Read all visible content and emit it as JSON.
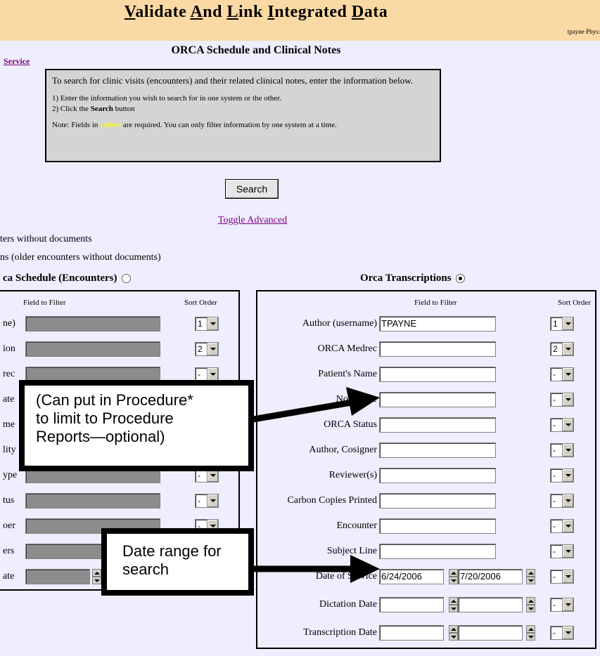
{
  "header": {
    "app_title_parts": [
      {
        "first": "V",
        "rest": "alidate "
      },
      {
        "first": "A",
        "rest": "nd "
      },
      {
        "first": "L",
        "rest": "ink "
      },
      {
        "first": "I",
        "rest": "ntegrated "
      },
      {
        "first": "D",
        "rest": "ata"
      }
    ],
    "user": "tpayne Phys:",
    "page_title": "ORCA Schedule and Clinical Notes",
    "service_link": "Service"
  },
  "instructions": {
    "intro": "To search for clinic visits (encounters) and their related clinical notes, enter the information below.",
    "step1": "1) Enter the information you wish to search for in one system or the other.",
    "step2_pre": "2) Click the ",
    "step2_bold": "Search",
    "step2_post": " button",
    "note_pre": "Note: Fields in ",
    "note_colored": "yellow",
    "note_post": " are required. You can only filter information by one system at a time."
  },
  "search_button": "Search",
  "toggle_advanced": "Toggle Advanced",
  "option_lines": [
    "ters without documents",
    "ns (older encounters without documents)"
  ],
  "left_section": {
    "title": "ca Schedule (Encounters)",
    "selected": false,
    "field_header": "Field to Filter",
    "sort_header": "Sort Order",
    "rows": [
      {
        "label": "ne)",
        "sort": "1"
      },
      {
        "label": "ion",
        "sort": "2"
      },
      {
        "label": "rec",
        "sort": "-"
      },
      {
        "label": "ate",
        "sort": "-"
      },
      {
        "label": "me",
        "sort": "-"
      },
      {
        "label": "lity",
        "sort": "-"
      },
      {
        "label": "ype",
        "sort": "-"
      },
      {
        "label": "tus",
        "sort": "-"
      },
      {
        "label": "oer",
        "sort": "-"
      },
      {
        "label": "ers",
        "sort": "-"
      },
      {
        "label": "ate",
        "sort": "-"
      }
    ]
  },
  "right_section": {
    "title": "Orca Transcriptions",
    "selected": true,
    "field_header": "Field to Filter",
    "sort_header": "Sort Order",
    "rows": [
      {
        "label": "Author (username)",
        "value": "TPAYNE",
        "sort": "1"
      },
      {
        "label": "ORCA Medrec",
        "value": "",
        "sort": "2"
      },
      {
        "label": "Patient's Name",
        "value": "",
        "sort": "-"
      },
      {
        "label": "Note Type",
        "value": "",
        "sort": "-"
      },
      {
        "label": "ORCA Status",
        "value": "",
        "sort": "-"
      },
      {
        "label": "Author, Cosigner",
        "value": "",
        "sort": "-"
      },
      {
        "label": "Reviewer(s)",
        "value": "",
        "sort": "-"
      },
      {
        "label": "Carbon Copies Printed",
        "value": "",
        "sort": "-"
      },
      {
        "label": "Encounter",
        "value": "",
        "sort": "-"
      },
      {
        "label": "Subject Line",
        "value": "",
        "sort": "-"
      },
      {
        "label": "Date of Service",
        "from": "6/24/2006",
        "to": "7/20/2006",
        "sort": "-"
      },
      {
        "label": "Dictation Date",
        "from": "",
        "to": "",
        "sort": "-"
      },
      {
        "label": "Transcription Date",
        "from": "",
        "to": "",
        "sort": "-"
      }
    ]
  },
  "callouts": {
    "procedure": [
      "(Can put in Procedure*",
      "to limit to Procedure",
      "Reports—optional)"
    ],
    "date_range": [
      "Date range for",
      "search"
    ]
  },
  "colors": {
    "banner": "#fad9a4",
    "page_bg": "#eeeeff",
    "link": "#800080",
    "instructions_bg": "#d4d4d4",
    "disabled_input": "#8c8c8c"
  }
}
